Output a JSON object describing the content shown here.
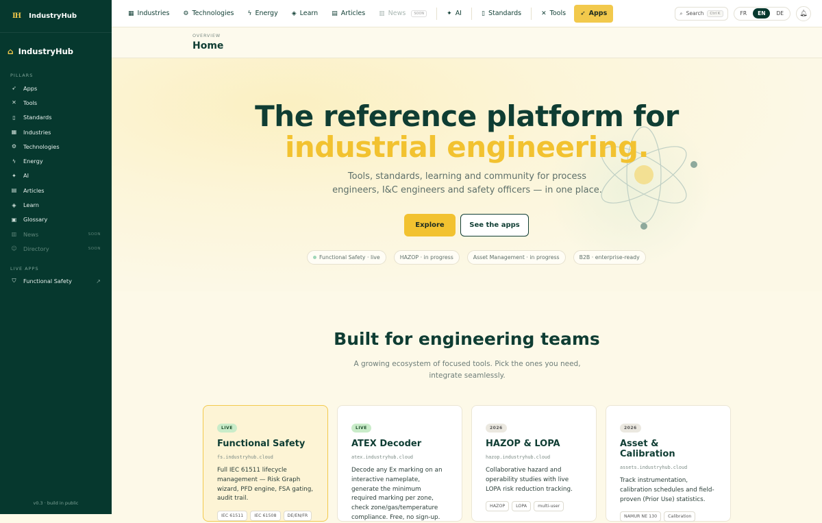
{
  "sidebar": {
    "logo_mark": "IH",
    "logo_text": "IndustryHub",
    "brand": "IndustryHub",
    "pillars_label": "PILLARS",
    "items": [
      {
        "label": "Apps",
        "icon": "rocket-icon"
      },
      {
        "label": "Tools",
        "icon": "wrench-icon"
      },
      {
        "label": "Standards",
        "icon": "bookmark-icon"
      },
      {
        "label": "Industries",
        "icon": "building-icon"
      },
      {
        "label": "Technologies",
        "icon": "cog-icon"
      },
      {
        "label": "Energy",
        "icon": "bolt-icon"
      },
      {
        "label": "AI",
        "icon": "sparkle-icon"
      },
      {
        "label": "Articles",
        "icon": "document-icon"
      },
      {
        "label": "Learn",
        "icon": "graduation-icon"
      },
      {
        "label": "Glossary",
        "icon": "book-icon"
      },
      {
        "label": "News",
        "icon": "newspaper-icon",
        "soon": "SOON"
      },
      {
        "label": "Directory",
        "icon": "people-icon",
        "soon": "SOON"
      }
    ],
    "live_apps_label": "LIVE APPS",
    "live_apps": [
      {
        "label": "Functional Safety",
        "icon": "shield-icon"
      }
    ],
    "footer": "v0.3 · build in public"
  },
  "topbar": {
    "nav": [
      {
        "label": "Industries"
      },
      {
        "label": "Technologies"
      },
      {
        "label": "Energy"
      },
      {
        "label": "Learn"
      },
      {
        "label": "Articles"
      },
      {
        "label": "News",
        "soon": "SOON"
      },
      {
        "label": "AI"
      },
      {
        "label": "Standards"
      },
      {
        "label": "Tools"
      },
      {
        "label": "Apps"
      }
    ],
    "search_label": "Search",
    "search_kbd": "Ctrl K",
    "languages": [
      "FR",
      "EN",
      "DE"
    ],
    "active_language": "EN"
  },
  "header": {
    "eyebrow": "OVERVIEW",
    "title": "Home"
  },
  "hero": {
    "title_line1": "The reference platform for",
    "title_line2": "industrial engineering.",
    "subtitle": "Tools, standards, learning and community for process engineers, I&C engineers and safety officers — in one place.",
    "primary_button": "Explore",
    "secondary_button": "See the apps",
    "pills": [
      "Functional Safety · live",
      "HAZOP · in progress",
      "Asset Management · in progress",
      "B2B · enterprise-ready"
    ]
  },
  "section": {
    "title": "Built for engineering teams",
    "subtitle": "A growing ecosystem of focused tools. Pick the ones you need, integrate seamlessly."
  },
  "cards": [
    {
      "badge": "LIVE",
      "title": "Functional Safety",
      "domain": "fs.industryhub.cloud",
      "desc": "Full IEC 61511 lifecycle management — Risk Graph wizard, PFD engine, FSA gating, audit trail.",
      "tags": [
        "IEC 61511",
        "IEC 61508",
        "DE/EN/FR"
      ]
    },
    {
      "badge": "LIVE",
      "title": "ATEX Decoder",
      "domain": "atex.industryhub.cloud",
      "desc": "Decode any Ex marking on an interactive nameplate, generate the minimum required marking per zone, check zone/gas/temperature compliance. Free, no sign-up.",
      "tags": []
    },
    {
      "badge": "2026",
      "title": "HAZOP & LOPA",
      "domain": "hazop.industryhub.cloud",
      "desc": "Collaborative hazard and operability studies with live LOPA risk reduction tracking.",
      "tags": [
        "HAZOP",
        "LOPA",
        "multi-user"
      ]
    },
    {
      "badge": "2026",
      "title": "Asset & Calibration",
      "domain": "assets.industryhub.cloud",
      "desc": "Track instrumentation, calibration schedules and field-proven (Prior Use) statistics.",
      "tags": [
        "NAMUR NE 130",
        "Calibration"
      ]
    }
  ],
  "colors": {
    "sidebar": "#06382e",
    "accent": "#f2c230",
    "text": "#0f3d33"
  }
}
